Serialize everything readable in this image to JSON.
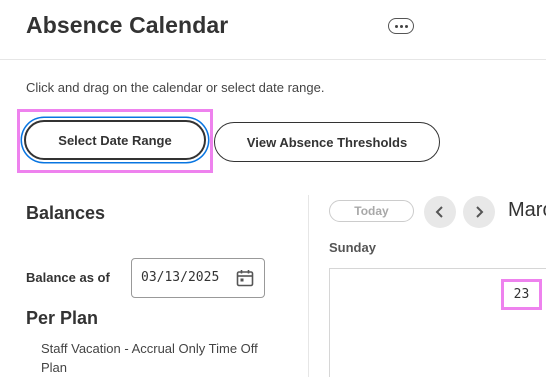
{
  "header": {
    "title": "Absence Calendar",
    "more_icon": "more-horizontal-icon"
  },
  "instructions": "Click and drag on the calendar or select date range.",
  "actions": {
    "select_date_range": "Select Date Range",
    "view_absence_thresholds": "View Absence Thresholds"
  },
  "balances": {
    "heading": "Balances",
    "as_of_label": "Balance as of",
    "as_of_value": "03/13/2025",
    "per_plan_heading": "Per Plan",
    "plans": [
      {
        "name": "Staff Vacation - Accrual Only Time Off Plan"
      }
    ]
  },
  "calendar": {
    "today_label": "Today",
    "month_label": "Marc",
    "weekdays": [
      "Sunday"
    ],
    "visible_day": "23"
  },
  "colors": {
    "highlight": "#ee82ee",
    "focus_ring": "#0875e1",
    "text": "#333333"
  }
}
